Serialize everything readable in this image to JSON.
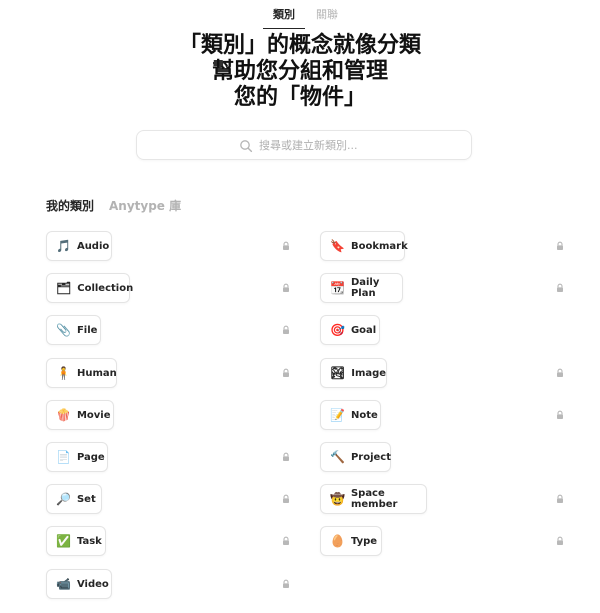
{
  "tabs": [
    {
      "label": "類別",
      "active": true
    },
    {
      "label": "關聯",
      "active": false
    }
  ],
  "headline": {
    "line1": "「類別」的概念就像分類",
    "line2": "幫助您分組和管理",
    "line3": "您的「物件」"
  },
  "search": {
    "placeholder": "搜尋或建立新類別..."
  },
  "sections": [
    {
      "label": "我的類別",
      "active": true
    },
    {
      "label": "Anytype 庫",
      "active": false
    }
  ],
  "types": [
    {
      "label": "Audio",
      "icon": "music-note-icon",
      "emoji": "🎵",
      "locked": true
    },
    {
      "label": "Bookmark",
      "icon": "bookmark-icon",
      "emoji": "🔖",
      "locked": true
    },
    {
      "label": "Collection",
      "icon": "collection-box-icon",
      "emoji": "🗂",
      "locked": true
    },
    {
      "label": "Daily Plan",
      "icon": "calendar-icon",
      "emoji": "📆",
      "locked": true
    },
    {
      "label": "File",
      "icon": "paperclip-icon",
      "emoji": "📎",
      "locked": true
    },
    {
      "label": "Goal",
      "icon": "target-icon",
      "emoji": "🎯",
      "locked": false
    },
    {
      "label": "Human",
      "icon": "person-icon",
      "emoji": "🧍",
      "locked": true
    },
    {
      "label": "Image",
      "icon": "picture-icon",
      "emoji": "🏞",
      "locked": true
    },
    {
      "label": "Movie",
      "icon": "popcorn-icon",
      "emoji": "🍿",
      "locked": false
    },
    {
      "label": "Note",
      "icon": "memo-icon",
      "emoji": "📝",
      "locked": true
    },
    {
      "label": "Page",
      "icon": "page-icon",
      "emoji": "📄",
      "locked": true
    },
    {
      "label": "Project",
      "icon": "hammer-icon",
      "emoji": "🔨",
      "locked": false
    },
    {
      "label": "Set",
      "icon": "magnifier-icon",
      "emoji": "🔎",
      "locked": true
    },
    {
      "label": "Space member",
      "icon": "face-icon",
      "emoji": "🤠",
      "locked": true
    },
    {
      "label": "Task",
      "icon": "checkmark-icon",
      "emoji": "✅",
      "locked": true
    },
    {
      "label": "Type",
      "icon": "egg-icon",
      "emoji": "🥚",
      "locked": true
    },
    {
      "label": "Video",
      "icon": "video-camera-icon",
      "emoji": "📹",
      "locked": true
    }
  ],
  "colors": {
    "text": "#252525",
    "muted": "#b3b3b3",
    "border": "#e4e4e4",
    "lock": "#b8b8b8"
  }
}
